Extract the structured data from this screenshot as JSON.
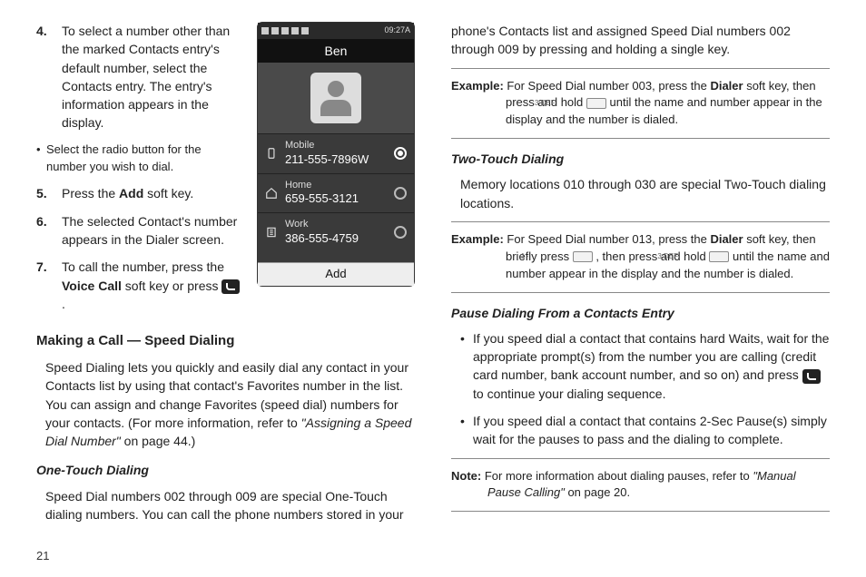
{
  "page_number": "21",
  "left": {
    "items": [
      {
        "num": "4.",
        "text": "To select a number other than the marked Contacts entry's default number, select the Contacts entry. The entry's information appears in the display.",
        "sub": "Select the radio button for the number you wish to dial."
      },
      {
        "num": "5.",
        "text_pre": "Press the ",
        "bold": "Add",
        "text_post": " soft key."
      },
      {
        "num": "6.",
        "text": "The selected Contact's number appears in the Dialer screen."
      },
      {
        "num": "7.",
        "text_pre": "To call the number, press the ",
        "bold": "Voice Call",
        "text_post": " soft key or press "
      }
    ],
    "h2": "Making a Call — Speed Dialing",
    "speed_para_a": "Speed Dialing lets you quickly and easily dial any contact in your Contacts list by using that contact's Favorites number in the list. You can assign and change Favorites (speed dial) numbers for your contacts. (For more information, refer to ",
    "speed_ref": "\"Assigning a Speed Dial Number\"",
    "speed_para_b": "  on page 44.)",
    "h3": "One-Touch Dialing",
    "one_touch": "Speed Dial numbers 002 through 009 are special One-Touch dialing numbers. You can call the phone numbers stored in your"
  },
  "right": {
    "cont": "phone's Contacts list and assigned Speed Dial numbers 002 through 009 by pressing and holding a single key.",
    "ex1_lead": "Example:",
    "ex1_a": " For Speed Dial number 003, press the ",
    "ex1_bold": "Dialer",
    "ex1_b": " soft key, then press and hold ",
    "ex1_key": "3 DEF",
    "ex1_c": " until the name and number appear in the display and the number is dialed.",
    "h3a": "Two-Touch Dialing",
    "two_touch": "Memory locations 010 through 030 are special Two-Touch dialing locations.",
    "ex2_lead": "Example:",
    "ex2_a": " For Speed Dial number 013, press the ",
    "ex2_bold": "Dialer",
    "ex2_b": " soft key, then briefly press ",
    "ex2_key1": "1 ·",
    "ex2_c": " , then press and hold ",
    "ex2_key2": "3 DEF",
    "ex2_d": " until the name and number appear in the display and the number is dialed.",
    "h3b": "Pause Dialing From a Contacts Entry",
    "pb1_a": "If you speed dial a contact that contains hard Waits, wait for the appropriate prompt(s) from the number you are calling (credit card number, bank account number, and so on) and press ",
    "pb1_b": " to continue your dialing sequence.",
    "pb2": "If you speed dial a contact that contains 2-Sec Pause(s) simply wait for the pauses to pass and the dialing to complete.",
    "note_lead": "Note:",
    "note_a": "  For more information about dialing pauses, refer to ",
    "note_ref": "\"Manual Pause Calling\"",
    "note_b": " on page 20."
  },
  "phone": {
    "time": "09:27A",
    "name": "Ben",
    "rows": [
      {
        "label": "Mobile",
        "number": "211-555-7896W",
        "selected": true,
        "icon": "mobile"
      },
      {
        "label": "Home",
        "number": "659-555-3121",
        "selected": false,
        "icon": "home"
      },
      {
        "label": "Work",
        "number": "386-555-4759",
        "selected": false,
        "icon": "work"
      }
    ],
    "softkey": "Add"
  }
}
